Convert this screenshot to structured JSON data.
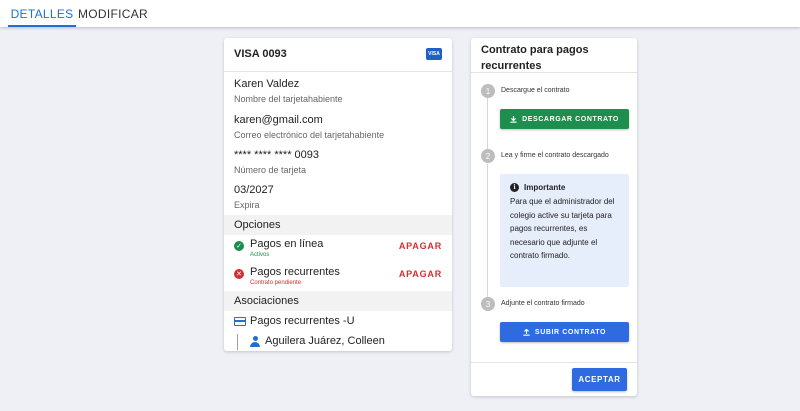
{
  "tabs": {
    "details": "DETALLES",
    "modify": "MODIFICAR"
  },
  "card": {
    "title": "VISA 0093",
    "brand_badge": "VISA",
    "holder_name": "Karen Valdez",
    "holder_name_label": "Nombre del tarjetahabiente",
    "email": "karen@gmail.com",
    "email_label": "Correo electrónico del tarjetahabiente",
    "number": "**** **** **** 0093",
    "number_label": "Número de tarjeta",
    "expiry": "03/2027",
    "expiry_label": "Expira"
  },
  "options": {
    "title": "Opciones",
    "items": [
      {
        "label": "Pagos en línea",
        "status": "Activos",
        "action": "APAGAR",
        "icon": "check-circle-icon",
        "color": "#1e8e4e"
      },
      {
        "label": "Pagos recurrentes",
        "status": "Contrato pendiente",
        "action": "APAGAR",
        "icon": "error-circle-icon",
        "color": "#d32f2f"
      }
    ]
  },
  "associations": {
    "title": "Asociaciones",
    "plan": "Pagos recurrentes -U",
    "person": "Aguilera Juárez, Colleen"
  },
  "contract": {
    "title": "Contrato para pagos recurrentes",
    "steps": [
      {
        "number": "1",
        "label": "Descargue el contrato"
      },
      {
        "number": "2",
        "label": "Lea y firme el contrato descargado"
      },
      {
        "number": "3",
        "label": "Adjunte el contrato firmado"
      }
    ],
    "download_button": "DESCARGAR CONTRATO",
    "info_title": "Importante",
    "info_body": "Para que el administrador del colegio active su tarjeta para pagos recurrentes, es necesario que adjunte el contrato firmado.",
    "upload_button": "SUBIR CONTRATO",
    "accept_button": "ACEPTAR"
  },
  "colors": {
    "accent": "#1e6fd9",
    "success": "#1e8e4e",
    "danger": "#d32f2f",
    "primary_button": "#2e6be0",
    "info_background": "#e6eefc"
  }
}
